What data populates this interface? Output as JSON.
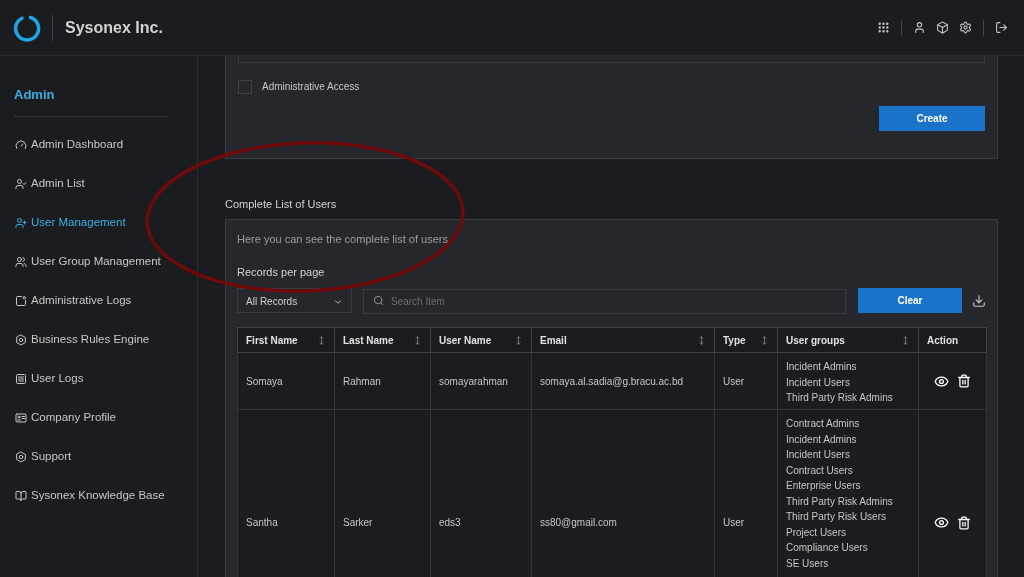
{
  "header": {
    "company": "Sysonex Inc."
  },
  "sidebar": {
    "title": "Admin",
    "items": [
      {
        "label": "Admin Dashboard",
        "selected": false
      },
      {
        "label": "Admin List",
        "selected": false
      },
      {
        "label": "User Management",
        "selected": true
      },
      {
        "label": "User Group Management",
        "selected": false
      },
      {
        "label": "Administrative Logs",
        "selected": false
      },
      {
        "label": "Business Rules Engine",
        "selected": false
      },
      {
        "label": "User Logs",
        "selected": false
      },
      {
        "label": "Company Profile",
        "selected": false
      },
      {
        "label": "Support",
        "selected": false
      },
      {
        "label": "Sysonex Knowledge Base",
        "selected": false
      }
    ]
  },
  "create_form": {
    "administrative_access": {
      "label": "Administrative Access",
      "checked": false
    },
    "create_button": "Create"
  },
  "users_section": {
    "title": "Complete List of Users",
    "description": "Here you can see the complete list of users",
    "records_label": "Records per page",
    "records_select": {
      "value": "All Records"
    },
    "search": {
      "placeholder": "Search Item"
    },
    "clear_button": "Clear"
  },
  "table": {
    "columns": [
      {
        "label": "First Name",
        "sortable": true
      },
      {
        "label": "Last Name",
        "sortable": true
      },
      {
        "label": "User Name",
        "sortable": true
      },
      {
        "label": "Email",
        "sortable": true
      },
      {
        "label": "Type",
        "sortable": true
      },
      {
        "label": "User groups",
        "sortable": true
      },
      {
        "label": "Action",
        "sortable": false
      }
    ],
    "rows": [
      {
        "first_name": "Somaya",
        "last_name": "Rahman",
        "user_name": "somayarahman",
        "email": "somaya.al.sadia@g.bracu.ac.bd",
        "type": "User",
        "user_groups": [
          "Incident Admins",
          "Incident Users",
          "Third Party Risk Admins"
        ]
      },
      {
        "first_name": "Santha",
        "last_name": "Sarker",
        "user_name": "eds3",
        "email": "ss80@gmail.com",
        "type": "User",
        "user_groups": [
          "Contract Admins",
          "Incident Admins",
          "Incident Users",
          "Contract Users",
          "Enterprise Users",
          "Third Party Risk Admins",
          "Third Party Risk Users",
          "Project Users",
          "Compliance Users",
          "SE Users"
        ]
      }
    ]
  }
}
